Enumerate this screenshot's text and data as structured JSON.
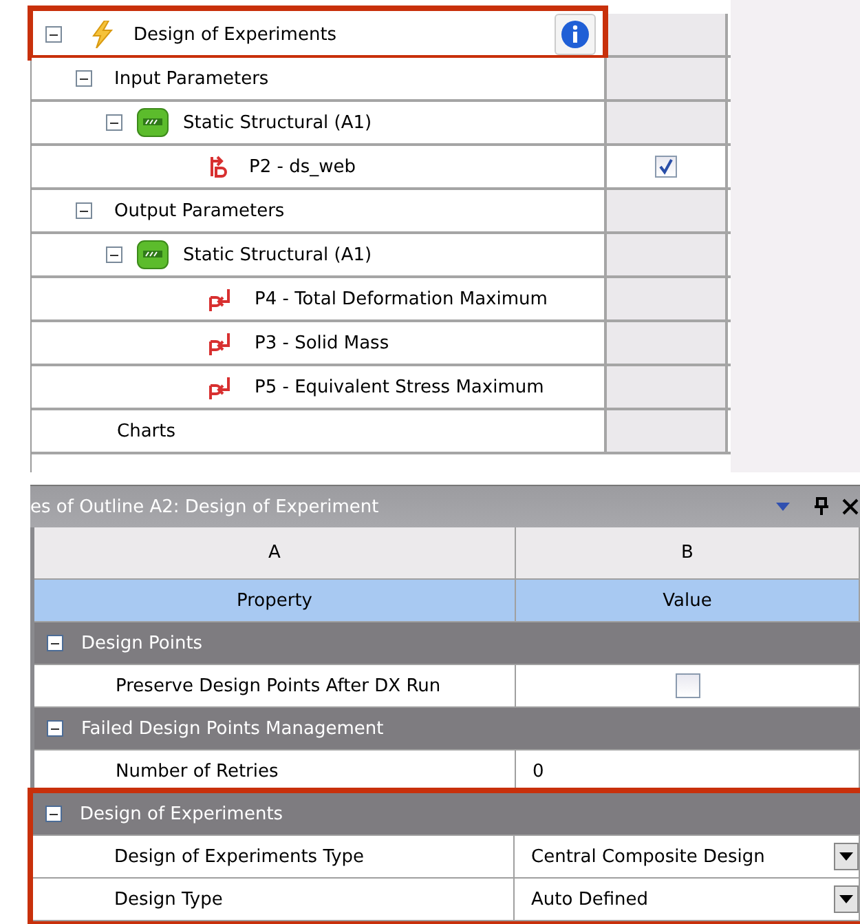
{
  "outline": {
    "items": [
      {
        "label": "Design of Experiments",
        "kind": "lightning",
        "expanded": true,
        "highlighted": true,
        "info": true,
        "children": [
          {
            "label": "Input Parameters",
            "expanded": true,
            "children": [
              {
                "label": "Static Structural (A1)",
                "kind": "system",
                "expanded": true,
                "children": [
                  {
                    "label": "P2 - ds_web",
                    "kind": "input-param",
                    "checkbox": {
                      "checked": true
                    }
                  }
                ]
              }
            ]
          },
          {
            "label": "Output Parameters",
            "expanded": true,
            "children": [
              {
                "label": "Static Structural (A1)",
                "kind": "system",
                "expanded": true,
                "children": [
                  {
                    "label": "P4 - Total Deformation Maximum",
                    "kind": "output-param"
                  },
                  {
                    "label": "P3 - Solid Mass",
                    "kind": "output-param"
                  },
                  {
                    "label": "P5 - Equivalent Stress Maximum",
                    "kind": "output-param"
                  }
                ]
              }
            ]
          },
          {
            "label": "Charts"
          }
        ]
      }
    ]
  },
  "properties": {
    "title": "es of Outline A2: Design of Experiment",
    "columns": [
      "A",
      "B"
    ],
    "header": [
      "Property",
      "Value"
    ],
    "groups": [
      {
        "title": "Design Points",
        "expanded": true,
        "highlighted": false,
        "rows": [
          {
            "property": "Preserve Design Points After DX Run",
            "kind": "checkbox",
            "checked": false
          }
        ]
      },
      {
        "title": "Failed Design Points Management",
        "expanded": true,
        "highlighted": false,
        "rows": [
          {
            "property": "Number of Retries",
            "kind": "text",
            "value": "0"
          }
        ]
      },
      {
        "title": "Design of Experiments",
        "expanded": true,
        "highlighted": true,
        "rows": [
          {
            "property": "Design of Experiments Type",
            "kind": "dropdown",
            "value": "Central Composite Design"
          },
          {
            "property": "Design Type",
            "kind": "dropdown",
            "value": "Auto Defined"
          }
        ]
      }
    ]
  }
}
